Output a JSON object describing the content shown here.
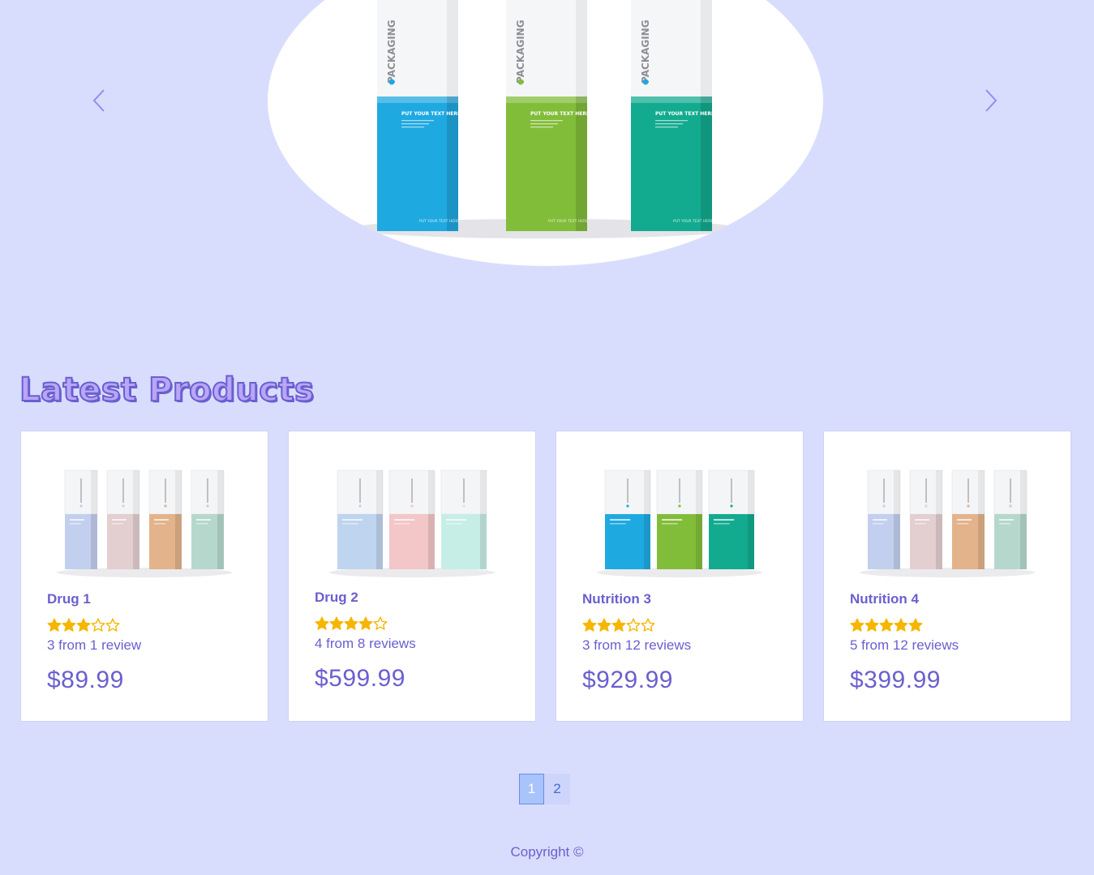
{
  "section": {
    "title": "Latest Products"
  },
  "products": [
    {
      "name": "Drug 1",
      "rating": 3,
      "rating_text": "3 from 1 review",
      "price": "$89.99",
      "colors": [
        "#c3cfee",
        "#e3cfd0",
        "#e3b38b",
        "#b6d8cc"
      ]
    },
    {
      "name": "Drug 2",
      "rating": 4,
      "rating_text": "4 from 8 reviews",
      "price": "$599.99",
      "colors": [
        "#bfd4ee",
        "#f3c6c8",
        "#c6eee6"
      ]
    },
    {
      "name": "Nutrition 3",
      "rating": 3,
      "rating_text": "3 from 12 reviews",
      "price": "$929.99",
      "colors": [
        "#1fa9e1",
        "#82bd3a",
        "#13ab8f"
      ]
    },
    {
      "name": "Nutrition 4",
      "rating": 5,
      "rating_text": "5 from 12 reviews",
      "price": "$399.99",
      "colors": [
        "#c3cfee",
        "#e3cfd0",
        "#e3b38b",
        "#b6d8cc"
      ]
    }
  ],
  "pagination": {
    "pages": [
      "1",
      "2"
    ],
    "current": "1"
  },
  "footer": {
    "copyright": "Copyright ©"
  },
  "hero": {
    "box_brand": "PACKAGING",
    "box_caption": "PUT YOUR TEXT HERE",
    "colors": [
      "#1fa9e1",
      "#82bd3a",
      "#13ab8f"
    ],
    "dot_colors": [
      "#1fa9e1",
      "#82bd3a",
      "#1fa9e1"
    ]
  },
  "theme": {
    "accent": "#6a5fd0",
    "background": "#d9ddfd",
    "star": "#f6b600"
  }
}
